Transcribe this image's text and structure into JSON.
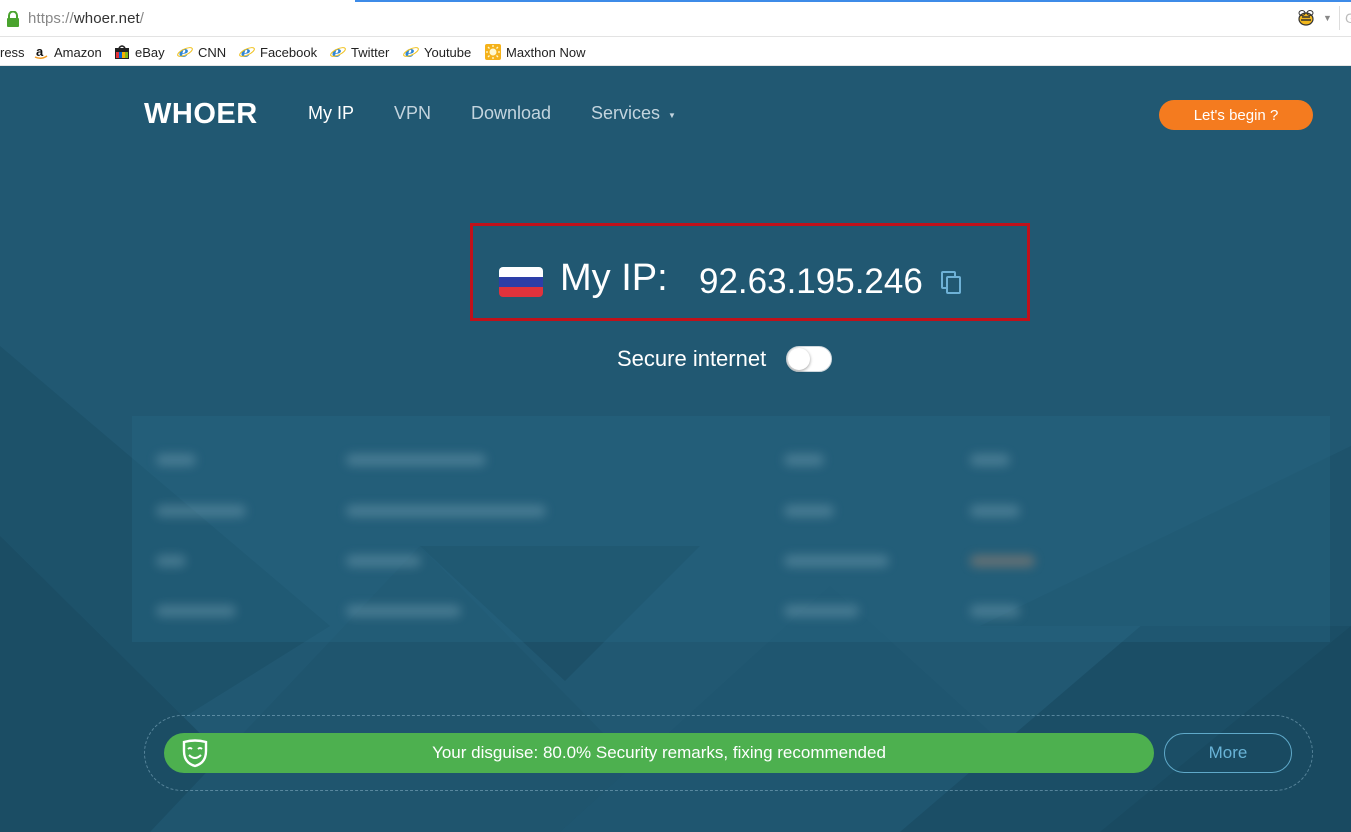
{
  "browser": {
    "url_scheme": "https://",
    "url_domain": "whoer.net",
    "url_path": "/",
    "overflow_glyph": "G",
    "bookmarks": [
      {
        "label": "ress",
        "icon": "partial-bookmark"
      },
      {
        "label": "Amazon",
        "icon": "amazon-icon"
      },
      {
        "label": "eBay",
        "icon": "ebay-icon"
      },
      {
        "label": "CNN",
        "icon": "ie-icon"
      },
      {
        "label": "Facebook",
        "icon": "ie-icon"
      },
      {
        "label": "Twitter",
        "icon": "ie-icon"
      },
      {
        "label": "Youtube",
        "icon": "ie-icon"
      },
      {
        "label": "Maxthon Now",
        "icon": "maxthon-icon"
      }
    ]
  },
  "site": {
    "logo": "WHOER",
    "nav": [
      {
        "label": "My IP",
        "active": true
      },
      {
        "label": "VPN",
        "active": false
      },
      {
        "label": "Download",
        "active": false
      },
      {
        "label": "Services",
        "active": false,
        "has_dropdown": true
      }
    ],
    "cta_label": "Let's begin ?"
  },
  "ip": {
    "label": "My IP:",
    "value": "92.63.195.246",
    "flag": "russia-flag-icon"
  },
  "secure_internet": {
    "label": "Secure internet",
    "enabled": false
  },
  "disguise": {
    "text": "Your disguise: 80.0% Security remarks, fixing recommended",
    "more_label": "More"
  },
  "colors": {
    "page_bg": "#215872",
    "accent_orange": "#f47b1f",
    "disguise_green": "#4db04f",
    "highlight_red": "#c0111a"
  }
}
